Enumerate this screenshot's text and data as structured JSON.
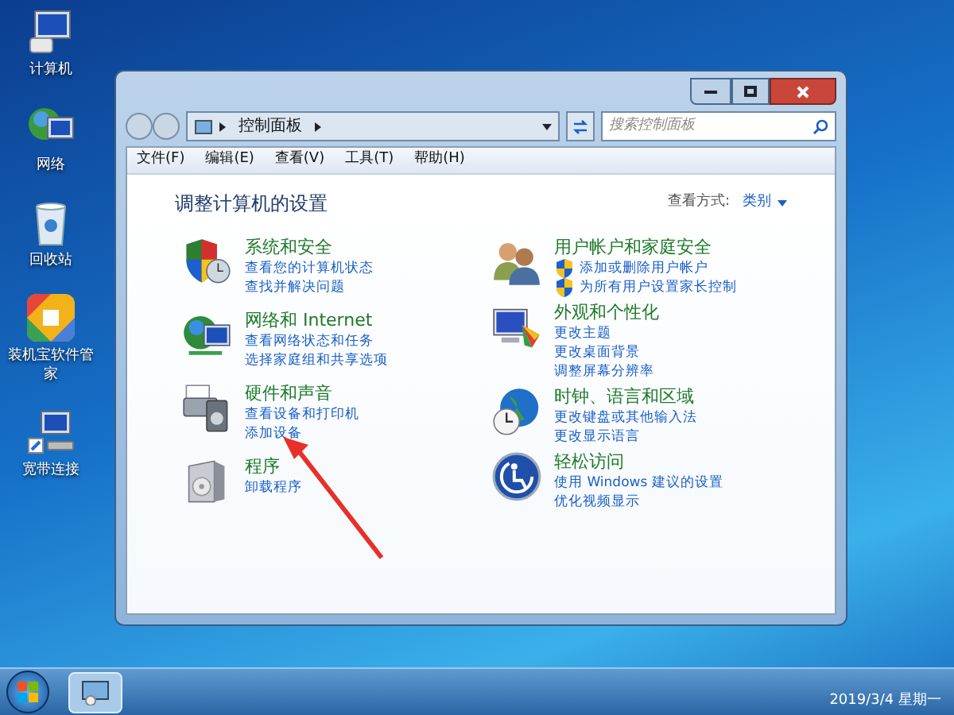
{
  "desktop_icons": [
    {
      "kind": "computer",
      "label": "计算机"
    },
    {
      "kind": "network",
      "label": "网络"
    },
    {
      "kind": "recycle",
      "label": "回收站"
    },
    {
      "kind": "app",
      "label": "装机宝软件管家"
    },
    {
      "kind": "broadband",
      "label": "宽带连接"
    }
  ],
  "window": {
    "breadcrumb": "控制面板",
    "search": {
      "placeholder": "搜索控制面板"
    },
    "menu": [
      "文件(F)",
      "编辑(E)",
      "查看(V)",
      "工具(T)",
      "帮助(H)"
    ],
    "heading": "调整计算机的设置",
    "view_by": {
      "label": "查看方式:",
      "value": "类别"
    },
    "categories": [
      {
        "kind": "security",
        "title": "系统和安全",
        "links": [
          {
            "text": "查看您的计算机状态",
            "shield": false
          },
          {
            "text": "查找并解决问题",
            "shield": false
          }
        ]
      },
      {
        "kind": "users",
        "title": "用户帐户和家庭安全",
        "links": [
          {
            "text": "添加或删除用户帐户",
            "shield": true
          },
          {
            "text": "为所有用户设置家长控制",
            "shield": true
          }
        ]
      },
      {
        "kind": "network",
        "title": "网络和 Internet",
        "links": [
          {
            "text": "查看网络状态和任务",
            "shield": false
          },
          {
            "text": "选择家庭组和共享选项",
            "shield": false
          }
        ]
      },
      {
        "kind": "appearance",
        "title": "外观和个性化",
        "links": [
          {
            "text": "更改主题",
            "shield": false
          },
          {
            "text": "更改桌面背景",
            "shield": false
          },
          {
            "text": "调整屏幕分辨率",
            "shield": false
          }
        ]
      },
      {
        "kind": "hardware",
        "title": "硬件和声音",
        "links": [
          {
            "text": "查看设备和打印机",
            "shield": false
          },
          {
            "text": "添加设备",
            "shield": false
          }
        ]
      },
      {
        "kind": "clock",
        "title": "时钟、语言和区域",
        "links": [
          {
            "text": "更改键盘或其他输入法",
            "shield": false
          },
          {
            "text": "更改显示语言",
            "shield": false
          }
        ]
      },
      {
        "kind": "programs",
        "title": "程序",
        "links": [
          {
            "text": "卸载程序",
            "shield": false
          }
        ]
      },
      {
        "kind": "access",
        "title": "轻松访问",
        "links": [
          {
            "text": "使用 Windows 建议的设置",
            "shield": false
          },
          {
            "text": "优化视频显示",
            "shield": false
          }
        ]
      }
    ]
  },
  "taskbar": {
    "date": "2019/3/4 星期一"
  }
}
